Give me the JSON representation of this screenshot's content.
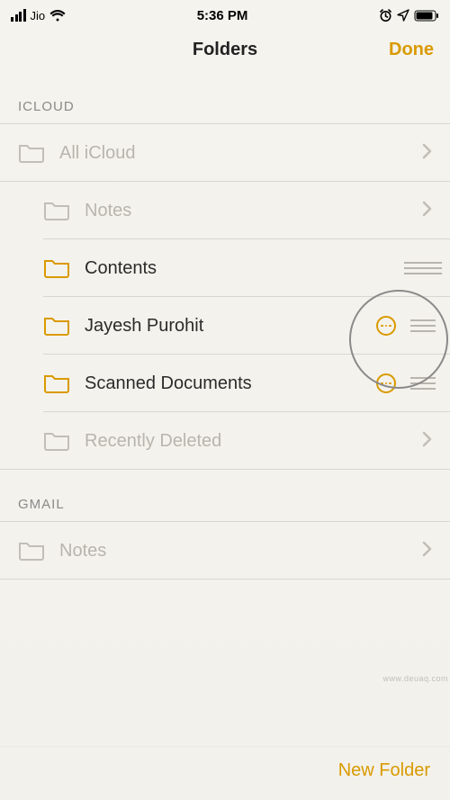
{
  "status_bar": {
    "carrier": "Jio",
    "time": "5:36 PM"
  },
  "nav": {
    "title": "Folders",
    "done_label": "Done"
  },
  "sections": {
    "icloud": {
      "header": "ICLOUD",
      "items": {
        "all_icloud": "All iCloud",
        "notes": "Notes",
        "contents": "Contents",
        "jayesh": "Jayesh Purohit",
        "scanned": "Scanned Documents",
        "recently_deleted": "Recently Deleted"
      }
    },
    "gmail": {
      "header": "GMAIL",
      "items": {
        "notes": "Notes"
      }
    }
  },
  "bottom": {
    "new_folder": "New Folder"
  },
  "watermark": "www.deuaq.com",
  "colors": {
    "accent": "#d99a00",
    "dim_text": "#b7b5ae",
    "text": "#2b2b2b"
  }
}
